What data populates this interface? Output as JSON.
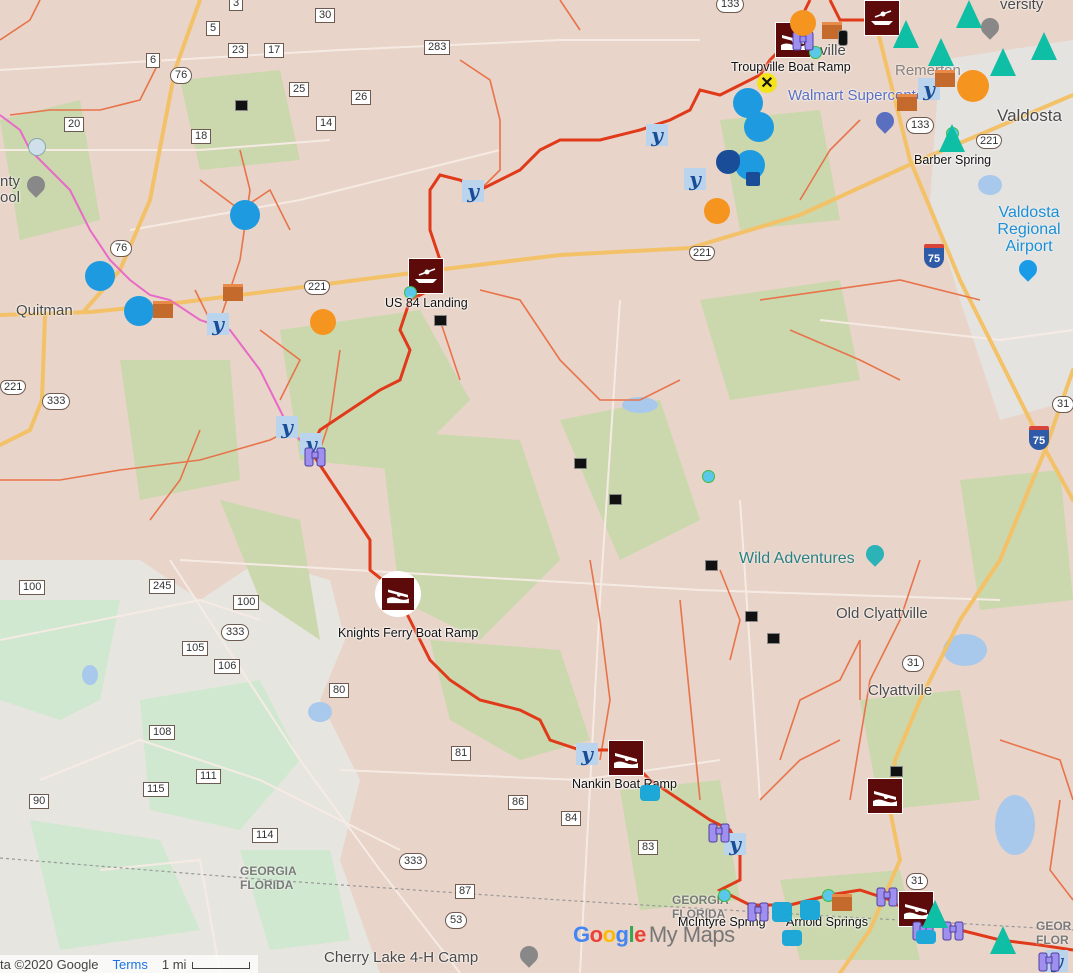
{
  "map": {
    "colors": {
      "land": "#e8d4c8",
      "forest": "#c9dcb0",
      "florida_land": "#e6e4df",
      "florida_forest": "#cdeccd",
      "water": "#a8c8ec",
      "route": "#e03a1a",
      "stream": "#e8734a",
      "pink_river": "#e86ac8",
      "highway": "#f3c168"
    },
    "places": [
      {
        "name": "Quitman",
        "id": "quitman"
      },
      {
        "name": "Valdosta",
        "id": "valdosta"
      },
      {
        "name": "Old Clyattville",
        "id": "old-clyattville"
      },
      {
        "name": "Clyattville",
        "id": "clyattville"
      },
      {
        "name": "Remerton",
        "id": "remerton"
      },
      {
        "name": "ville",
        "id": "troupville-town"
      },
      {
        "name": "versity",
        "id": "university"
      },
      {
        "name": "nty\nool",
        "id": "county-school"
      }
    ],
    "pois": {
      "walmart": "Walmart Supercenter",
      "wild_adventures": "Wild Adventures",
      "airport": "Valdosta Regional Airport",
      "cherry_lake": "Cherry Lake 4-H Camp"
    },
    "markers": [
      {
        "label": "Troupville Boat Ramp",
        "type": "boat-ramp"
      },
      {
        "label": "US 84 Landing",
        "type": "kayak-launch"
      },
      {
        "label": "Knights Ferry Boat Ramp",
        "type": "boat-ramp"
      },
      {
        "label": "Nankin Boat Ramp",
        "type": "boat-ramp"
      },
      {
        "label": "McIntyre Spring",
        "type": "spring"
      },
      {
        "label": "Arnold Springs",
        "type": "spring"
      },
      {
        "label": "Barber Spring",
        "type": "spring"
      }
    ],
    "state_labels": {
      "georgia": "GEORGIA",
      "florida": "FLORIDA",
      "georgia_short": "GEOR",
      "florida_short": "FLOR"
    },
    "road_shields": [
      {
        "num": "3"
      },
      {
        "num": "30"
      },
      {
        "num": "5"
      },
      {
        "num": "23"
      },
      {
        "num": "17"
      },
      {
        "num": "6"
      },
      {
        "num": "76"
      },
      {
        "num": "25"
      },
      {
        "num": "26"
      },
      {
        "num": "283"
      },
      {
        "num": "14"
      },
      {
        "num": "20"
      },
      {
        "num": "18"
      },
      {
        "num": "133"
      },
      {
        "num": "133"
      },
      {
        "num": "221"
      },
      {
        "num": "221"
      },
      {
        "num": "221"
      },
      {
        "num": "76"
      },
      {
        "num": "221"
      },
      {
        "num": "333"
      },
      {
        "num": "75"
      },
      {
        "num": "75"
      },
      {
        "num": "31"
      },
      {
        "num": "31"
      },
      {
        "num": "100"
      },
      {
        "num": "245"
      },
      {
        "num": "100"
      },
      {
        "num": "333"
      },
      {
        "num": "105"
      },
      {
        "num": "106"
      },
      {
        "num": "80"
      },
      {
        "num": "108"
      },
      {
        "num": "81"
      },
      {
        "num": "111"
      },
      {
        "num": "115"
      },
      {
        "num": "90"
      },
      {
        "num": "86"
      },
      {
        "num": "84"
      },
      {
        "num": "114"
      },
      {
        "num": "83"
      },
      {
        "num": "333"
      },
      {
        "num": "87"
      },
      {
        "num": "53"
      },
      {
        "num": "31"
      }
    ]
  },
  "footer": {
    "copyright": "ta ©2020 Google",
    "terms": "Terms",
    "scale": "1 mi"
  },
  "branding": {
    "google": [
      "G",
      "o",
      "o",
      "g",
      "l",
      "e"
    ],
    "my_maps": "My Maps"
  }
}
